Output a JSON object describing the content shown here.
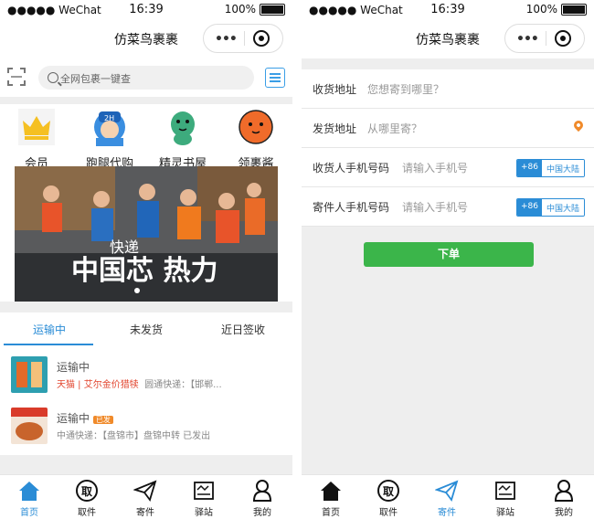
{
  "status": {
    "signal": "●●●●● WeChat",
    "time": "16:39",
    "battery": "100%"
  },
  "app": {
    "title": "仿菜鸟裹裹"
  },
  "capsule": {
    "more": "•••",
    "close_icon": "target-icon"
  },
  "home": {
    "search": {
      "placeholder": "全网包裹一键查"
    },
    "menu": [
      {
        "label": "会员",
        "icon": "crown-icon"
      },
      {
        "label": "跑腿代购",
        "icon": "courier-icon"
      },
      {
        "label": "精灵书屋",
        "icon": "dinosaur-icon"
      },
      {
        "label": "领裹酱",
        "icon": "orange-mascot-icon"
      }
    ],
    "banner": {
      "text": "中国芯 热力",
      "text_top": "快递"
    },
    "tabs": [
      "运输中",
      "未发货",
      "近日签收"
    ],
    "packages": [
      {
        "status": "运输中",
        "badge": "",
        "shop": "天猫 | 艾尔金价猎犊",
        "detail": "圆通快递：【邯郸..."
      },
      {
        "status": "运输中",
        "badge": "已发",
        "shop": "",
        "detail": "中通快递：【盘锦市】盘锦中转 已发出"
      }
    ]
  },
  "tabbar": [
    {
      "label": "首页",
      "icon": "home-icon"
    },
    {
      "label": "取件",
      "icon": "pickup-icon"
    },
    {
      "label": "寄件",
      "icon": "send-icon"
    },
    {
      "label": "驿站",
      "icon": "station-icon"
    },
    {
      "label": "我的",
      "icon": "user-icon"
    }
  ],
  "send": {
    "fields": [
      {
        "label": "收货地址",
        "placeholder": "您想寄到哪里？"
      },
      {
        "label": "发货地址",
        "placeholder": "从哪里寄？"
      },
      {
        "label": "收货人手机号码",
        "placeholder": "请输入手机号",
        "code": "+86",
        "region": "中国大陆"
      },
      {
        "label": "寄件人手机号码",
        "placeholder": "请输入手机号",
        "code": "+86",
        "region": "中国大陆"
      }
    ],
    "submit": "下单"
  },
  "colors": {
    "accent": "#2a8cd6",
    "submit": "#3bb54a",
    "pin": "#f08a2a"
  }
}
